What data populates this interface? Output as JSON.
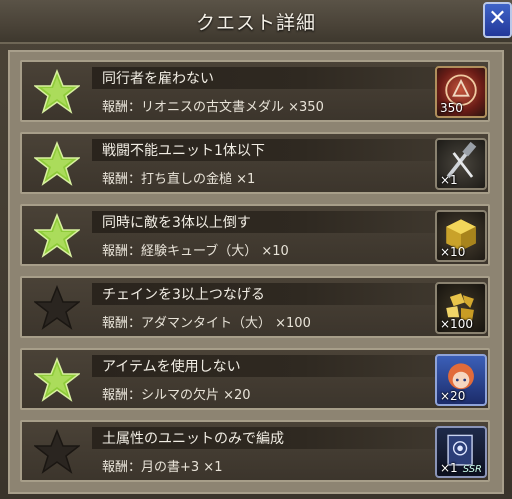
{
  "header": {
    "title": "クエスト詳細",
    "close_label": "✕"
  },
  "quests": [
    {
      "condition": "同行者を雇わない",
      "reward": "報酬：リオニスの古文書メダル ×350",
      "achieved": true,
      "item_icon": "medal-icon",
      "qty": "350"
    },
    {
      "condition": "戦闘不能ユニット1体以下",
      "reward": "報酬：打ち直しの金槌 ×1",
      "achieved": true,
      "item_icon": "hammer-icon",
      "qty": "×1"
    },
    {
      "condition": "同時に敵を3体以上倒す",
      "reward": "報酬：経験キューブ（大） ×10",
      "achieved": true,
      "item_icon": "exp-cube-icon",
      "qty": "×10"
    },
    {
      "condition": "チェインを3以上つなげる",
      "reward": "報酬：アダマンタイト（大） ×100",
      "achieved": false,
      "item_icon": "adamantite-icon",
      "qty": "×100"
    },
    {
      "condition": "アイテムを使用しない",
      "reward": "報酬：シルマの欠片 ×20",
      "achieved": true,
      "item_icon": "shard-icon",
      "qty": "×20"
    },
    {
      "condition": "土属性のユニットのみで編成",
      "reward": "報酬：月の書+3 ×1",
      "achieved": false,
      "item_icon": "moon-book-icon",
      "qty": "×1",
      "rarity": "SSR"
    }
  ],
  "colors": {
    "star_on": "#8fcc3a",
    "star_off": "#2a2520"
  }
}
